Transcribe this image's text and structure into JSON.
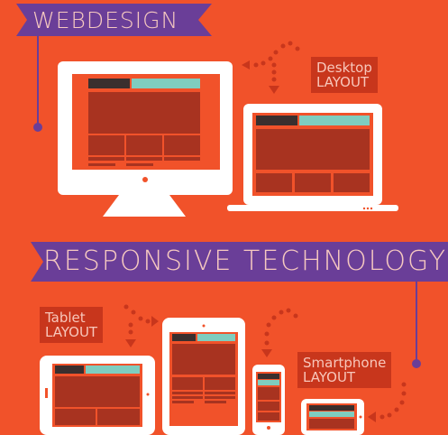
{
  "headings": {
    "top": "WEBDESIGN",
    "middle": "RESPONSIVE  TECHNOLOGY"
  },
  "labels": {
    "desktop": [
      "Desktop",
      "LAYOUT"
    ],
    "tablet": [
      "Tablet",
      "LAYOUT"
    ],
    "smartphone": [
      "Smartphone",
      "LAYOUT"
    ]
  },
  "colors": {
    "background": "#f1522a",
    "ribbon": "#6a3e98",
    "screen_panel": "#a83320",
    "header_dark": "#3a2f2e",
    "header_teal": "#7fcdbf",
    "device": "#ffffff"
  },
  "icons": [
    "desktop-monitor-icon",
    "laptop-icon",
    "tablet-icon",
    "smartphone-icon",
    "tablet-landscape-icon",
    "dotted-arrow-icon"
  ]
}
